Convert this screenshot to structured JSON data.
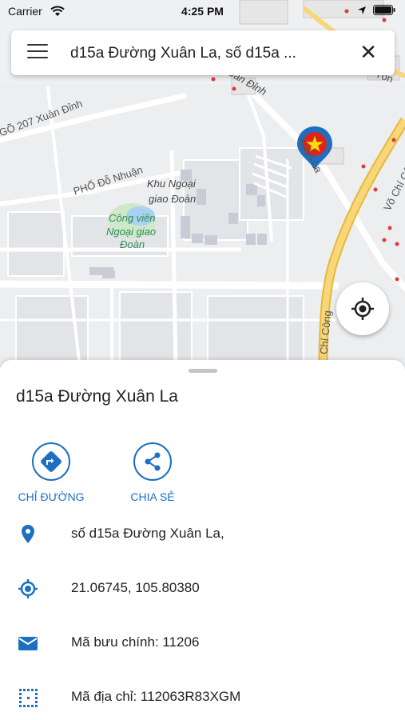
{
  "status_bar": {
    "carrier": "Carrier",
    "time": "4:25 PM"
  },
  "search": {
    "query": "d15a Đường Xuân La, số d15a ..."
  },
  "map": {
    "labels": {
      "xuan_dinh_top": "Xuân Đỉnh",
      "go207": "GÕ 207 Xuân Đỉnh",
      "pho_do_nhuan": "PHỐ Đỗ Nhuận",
      "khu_ngoai_1": "Khu Ngoại",
      "khu_ngoai_2": "giao Đoàn",
      "cong_vien_1": "Công viên",
      "cong_vien_2": "Ngoại giao",
      "cong_vien_3": "Đoàn",
      "xuan_la": "Xuân La",
      "vo_chi_cong": "Võ Chí Công",
      "chi_cong": "Chí Công",
      "tonl": "Tôn"
    }
  },
  "sheet": {
    "title": "d15a Đường Xuân La",
    "actions": [
      {
        "label": "CHỈ ĐƯỜNG",
        "icon": "directions-icon"
      },
      {
        "label": "CHIA SẺ",
        "icon": "share-icon"
      }
    ],
    "rows": [
      {
        "icon": "place-pin-icon",
        "text": "số d15a Đường Xuân La,"
      },
      {
        "icon": "gps-coordinates-icon",
        "text": "21.06745, 105.80380"
      },
      {
        "icon": "mail-icon",
        "text": "Mã bưu chính: 11206"
      },
      {
        "icon": "grid-code-icon",
        "text": "Mã địa chỉ: 112063R83XGM"
      }
    ]
  },
  "colors": {
    "accent": "#1e6fc1",
    "highway": "#f2c94c",
    "flag_red": "#da251d"
  }
}
